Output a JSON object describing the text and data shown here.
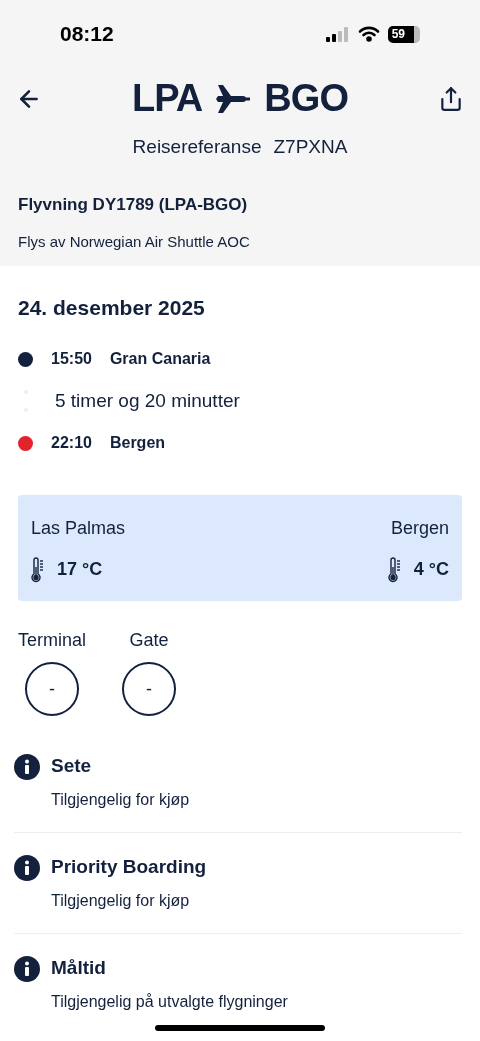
{
  "status_bar": {
    "time": "08:12",
    "battery": "59"
  },
  "header": {
    "origin": "LPA",
    "destination": "BGO",
    "reference_label": "Reisereferanse",
    "reference": "Z7PXNA"
  },
  "flight": {
    "title": "Flyvning DY1789 (LPA-BGO)",
    "operator": "Flys av Norwegian Air Shuttle AOC"
  },
  "date": "24. desember 2025",
  "stops": [
    {
      "time": "15:50",
      "place": "Gran Canaria",
      "color": "#14213d"
    },
    {
      "time": "22:10",
      "place": "Bergen",
      "color": "#e3222b"
    }
  ],
  "duration": "5 timer og 20 minutter",
  "weather": [
    {
      "city": "Las Palmas",
      "temperature": "17 °C"
    },
    {
      "city": "Bergen",
      "temperature": "4 °C"
    }
  ],
  "gates": [
    {
      "label": "Terminal",
      "value": "-"
    },
    {
      "label": "Gate",
      "value": "-"
    }
  ],
  "extras": [
    {
      "title": "Sete",
      "subtitle": "Tilgjengelig for kjøp"
    },
    {
      "title": "Priority Boarding",
      "subtitle": "Tilgjengelig for kjøp"
    },
    {
      "title": "Måltid",
      "subtitle": "Tilgjengelig på utvalgte flygninger"
    }
  ]
}
